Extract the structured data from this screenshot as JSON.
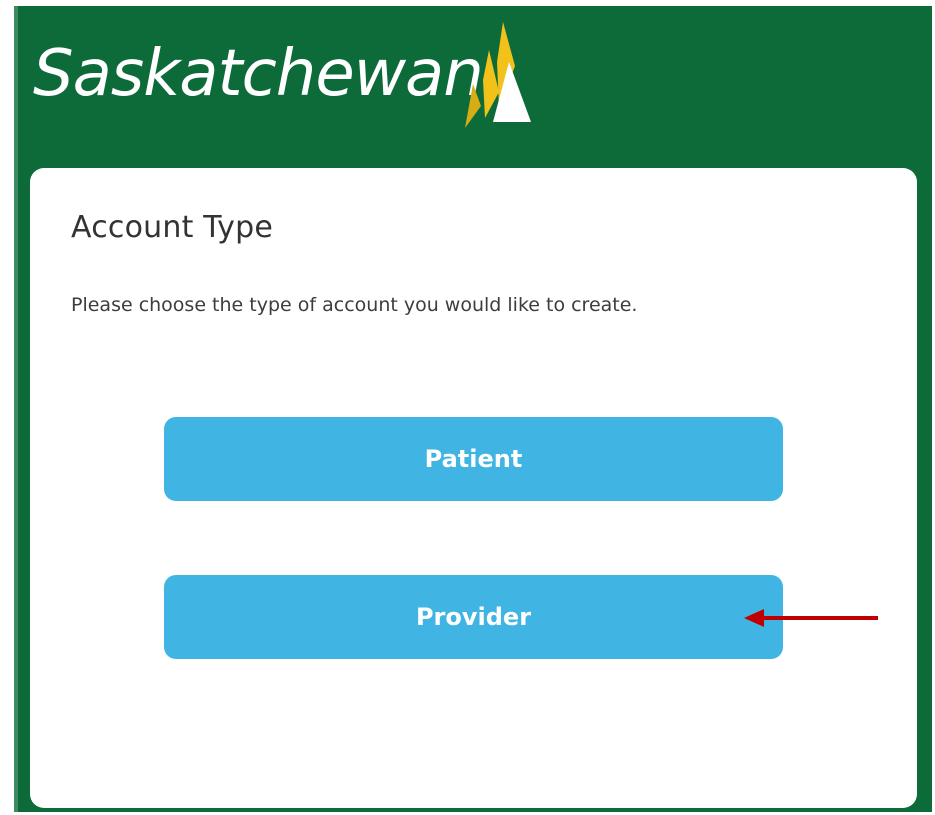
{
  "header": {
    "logo_text": "Saskatchewan",
    "brand_color": "#0d6b3a",
    "logo_mark": "wheat-sail-icon"
  },
  "card": {
    "title": "Account Type",
    "description": "Please choose the type of account you would like to create."
  },
  "options": {
    "patient_label": "Patient",
    "provider_label": "Provider",
    "button_color": "#40b4e2"
  },
  "annotation": {
    "arrow_color": "#c00000",
    "arrow_icon": "red-arrow-icon"
  }
}
